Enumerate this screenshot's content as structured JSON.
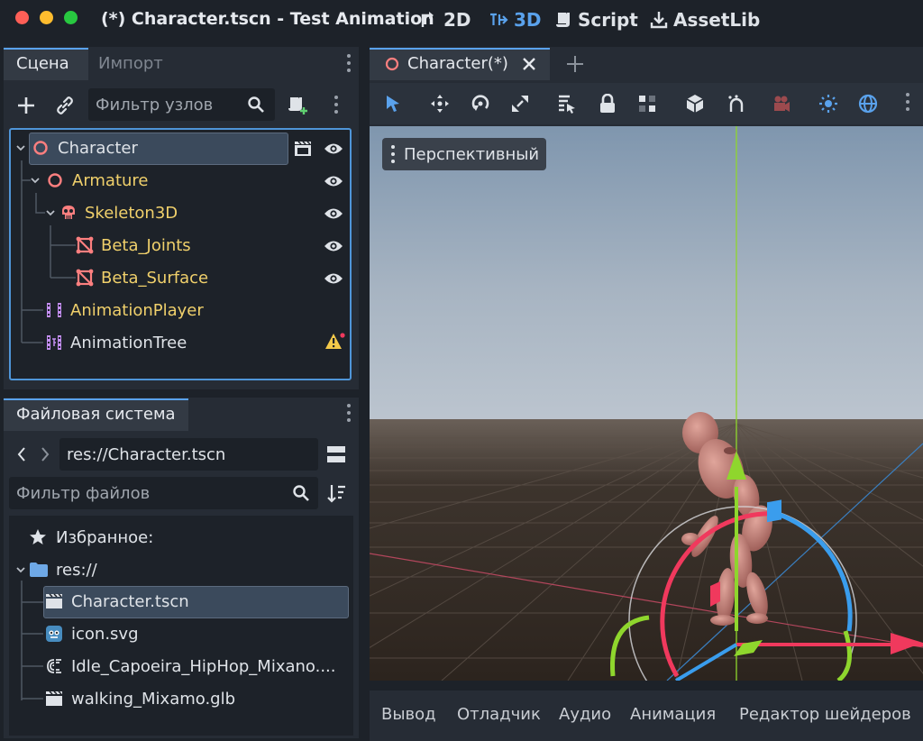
{
  "window": {
    "title": "(*) Character.tscn - Test Animation",
    "main_tabs": [
      {
        "label": "2D",
        "icon": "2d-icon"
      },
      {
        "label": "3D",
        "icon": "3d-icon",
        "active": true
      },
      {
        "label": "Script",
        "icon": "script-icon"
      },
      {
        "label": "AssetLib",
        "icon": "assetlib-icon"
      }
    ]
  },
  "scene_dock": {
    "tabs": [
      "Сцена",
      "Импорт"
    ],
    "filter_placeholder": "Фильтр узлов",
    "tree": [
      {
        "label": "Character",
        "icon": "node3d-icon",
        "selected": true
      },
      {
        "label": "Armature",
        "icon": "node3d-icon"
      },
      {
        "label": "Skeleton3D",
        "icon": "skeleton-icon"
      },
      {
        "label": "Beta_Joints",
        "icon": "mesh-icon"
      },
      {
        "label": "Beta_Surface",
        "icon": "mesh-icon"
      },
      {
        "label": "AnimationPlayer",
        "icon": "animation-player-icon"
      },
      {
        "label": "AnimationTree",
        "icon": "animation-tree-icon",
        "warning": true
      }
    ]
  },
  "filesystem_dock": {
    "tab": "Файловая система",
    "path": "res://Character.tscn",
    "filter_placeholder": "Фильтр файлов",
    "favorites_label": "Избранное:",
    "root_label": "res://",
    "files": [
      {
        "label": "Character.tscn",
        "icon": "scene-file-icon",
        "selected": true
      },
      {
        "label": "icon.svg",
        "icon": "svg-file-icon"
      },
      {
        "label": "Idle_Capoeira_HipHop_Mixano....",
        "icon": "glb-file-icon"
      },
      {
        "label": "walking_Mixamo.glb",
        "icon": "scene-file-icon"
      }
    ]
  },
  "editor": {
    "tab_label": "Character(*)",
    "view_mode": "Перспективный"
  },
  "bottom_panel": {
    "tabs": [
      "Вывод",
      "Отладчик",
      "Аудио",
      "Анимация",
      "Редактор шейдеров"
    ]
  },
  "colors": {
    "accent": "#5aa2ec",
    "node_name_yellow": "#f0d06b",
    "x_axis": "#f0395d",
    "y_axis": "#8fd62d",
    "z_axis": "#3a9ded"
  }
}
